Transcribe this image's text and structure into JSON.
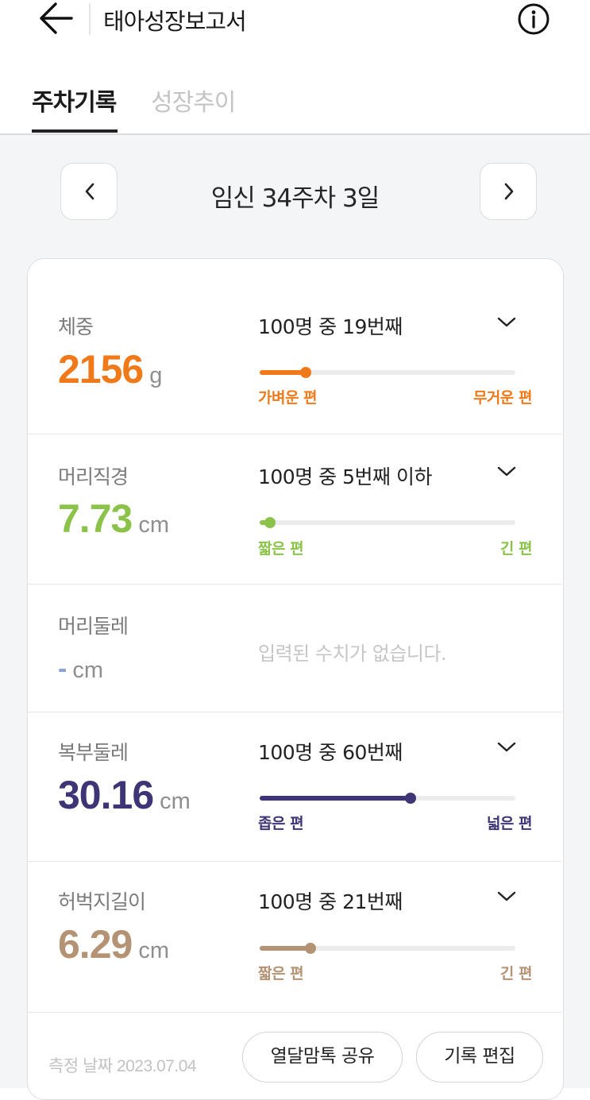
{
  "header": {
    "title": "태아성장보고서",
    "back_icon": "arrow-left-icon",
    "info_icon": "info-circle-icon"
  },
  "tabs": [
    {
      "label": "주차기록",
      "active": true
    },
    {
      "label": "성장추이",
      "active": false
    }
  ],
  "week": {
    "label": "임신 34주차 3일",
    "prev_icon": "chevron-left-icon",
    "next_icon": "chevron-right-icon"
  },
  "metrics": [
    {
      "label": "체중",
      "value": "2156",
      "unit": "g",
      "rank": "100명 중 19번째",
      "left_label": "가벼운 편",
      "right_label": "무거운 편",
      "position_percent": 18,
      "color": "#f07a1a"
    },
    {
      "label": "머리직경",
      "value": "7.73",
      "unit": "cm",
      "rank": "100명 중 5번째 이하",
      "left_label": "짧은 편",
      "right_label": "긴 편",
      "position_percent": 4,
      "color": "#8bc34a"
    },
    {
      "label": "머리둘레",
      "value": "-",
      "unit": "cm",
      "empty_message": "입력된 수치가 없습니다.",
      "color": "#8aa4cf"
    },
    {
      "label": "복부둘레",
      "value": "30.16",
      "unit": "cm",
      "rank": "100명 중 60번째",
      "left_label": "좁은 편",
      "right_label": "넓은 편",
      "position_percent": 59,
      "color": "#3d3575"
    },
    {
      "label": "허벅지길이",
      "value": "6.29",
      "unit": "cm",
      "rank": "100명 중 21번째",
      "left_label": "짧은 편",
      "right_label": "긴 편",
      "position_percent": 20,
      "color": "#b49274"
    }
  ],
  "footer": {
    "date": "측정 날짜 2023.07.04",
    "share_label": "열달맘톡 공유",
    "edit_label": "기록 편집"
  }
}
